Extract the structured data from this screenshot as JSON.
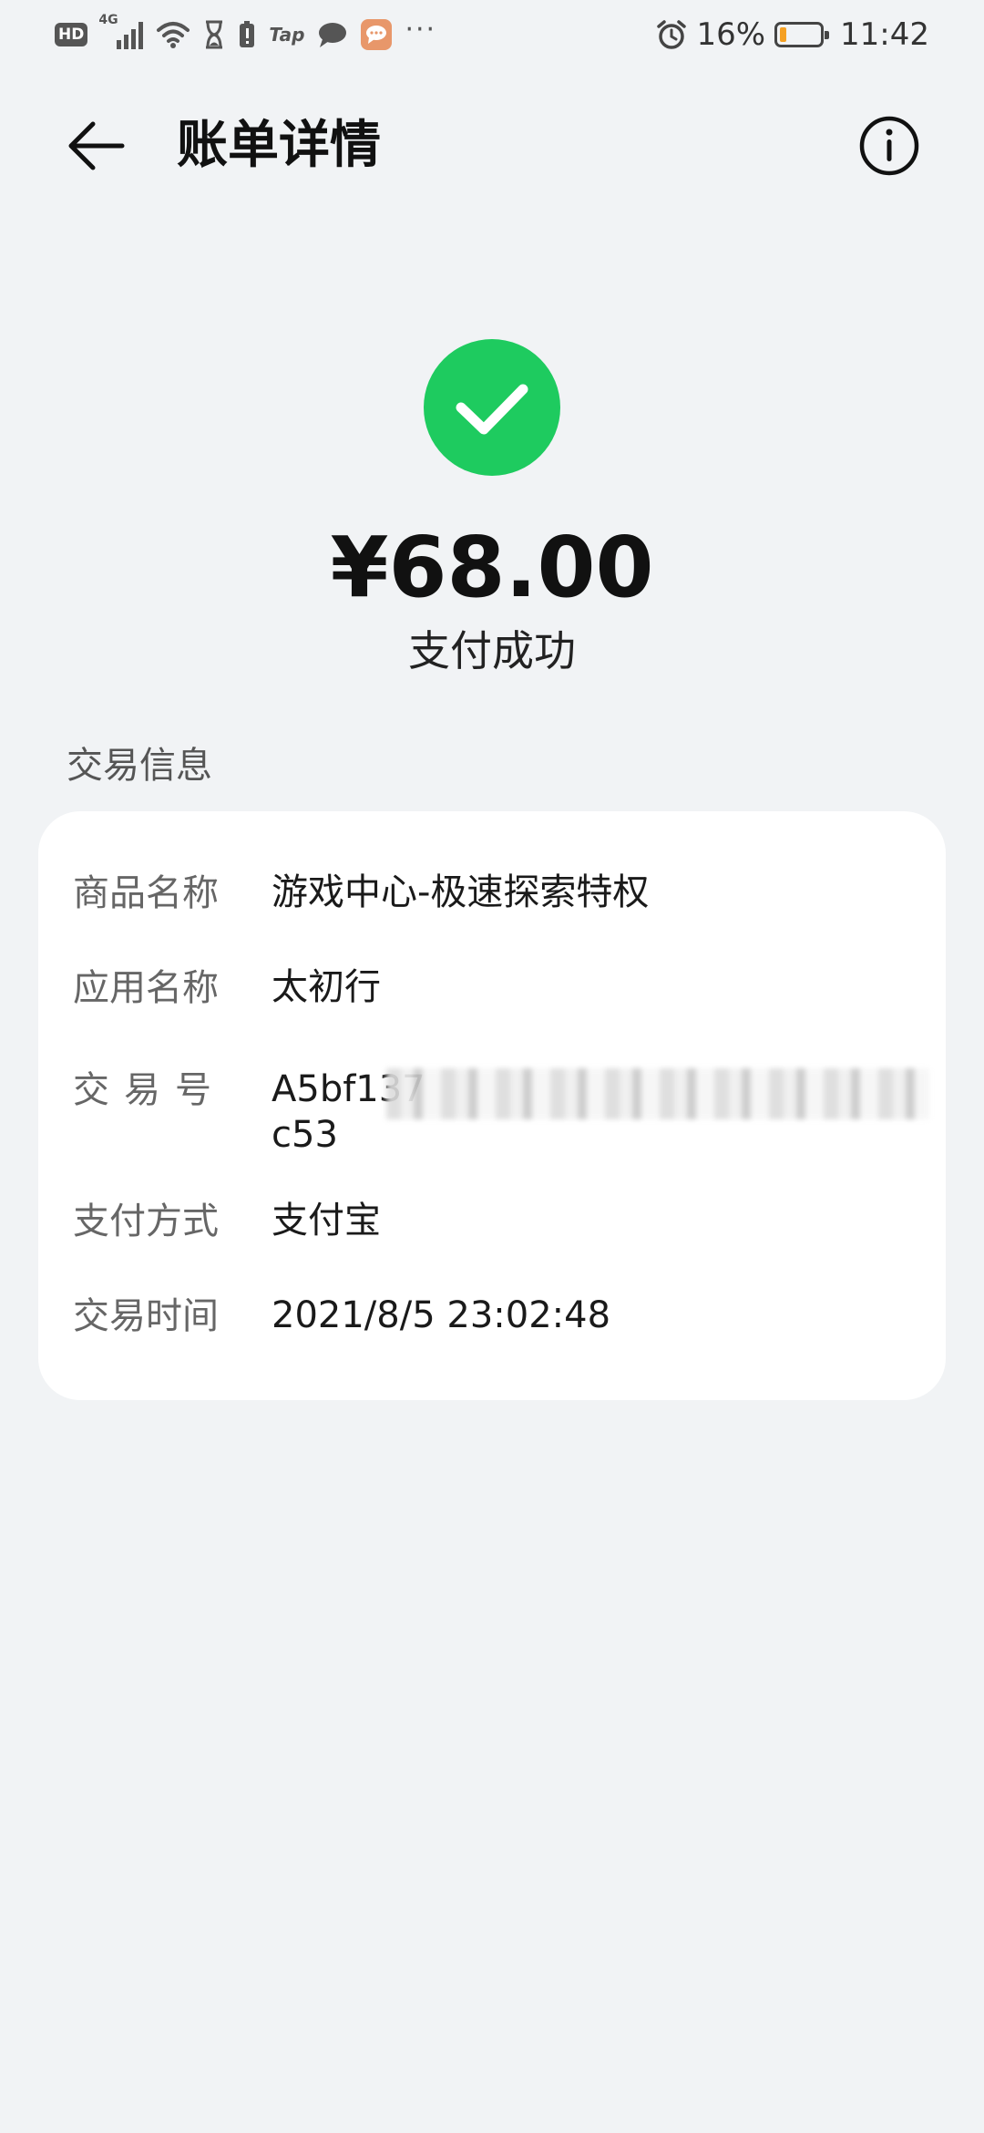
{
  "status_bar": {
    "hd": "HD",
    "network": "4G",
    "tap": "Tap",
    "more": "···",
    "battery_percent": "16%",
    "battery_level": 0.16,
    "time": "11:42"
  },
  "header": {
    "title": "账单详情"
  },
  "payment": {
    "amount": "¥68.00",
    "status": "支付成功",
    "accent_color": "#1ecb5f"
  },
  "transaction": {
    "section_title": "交易信息",
    "rows": [
      {
        "label": "商品名称",
        "value": "游戏中心-极速探索特权"
      },
      {
        "label": "应用名称",
        "value": "太初行"
      },
      {
        "label": "交易号",
        "value": "A5bf137",
        "value_line2": "c53"
      },
      {
        "label": "支付方式",
        "value": "支付宝"
      },
      {
        "label": "交易时间",
        "value": "2021/8/5 23:02:48"
      }
    ]
  }
}
